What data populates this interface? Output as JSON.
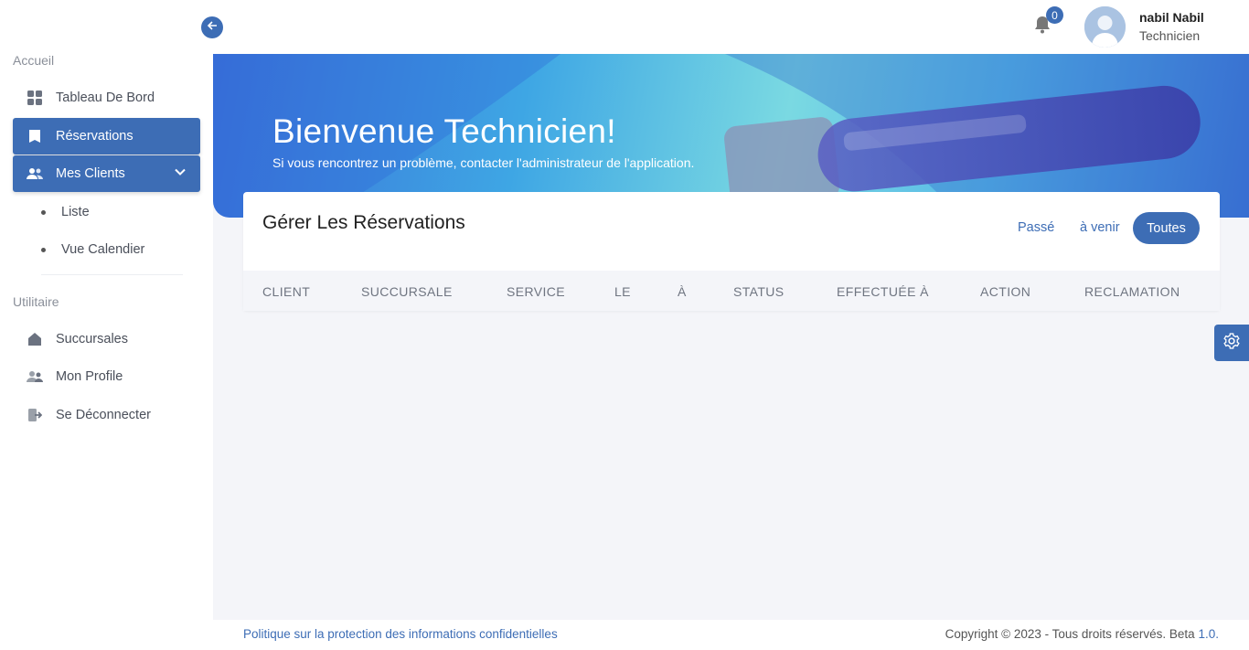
{
  "sidebar": {
    "section_home": "Accueil",
    "section_utility": "Utilitaire",
    "items": {
      "dashboard": "Tableau De Bord",
      "reservations": "Réservations",
      "clients": "Mes Clients",
      "list": "Liste",
      "calendar": "Vue Calendier",
      "branches": "Succursales",
      "profile": "Mon Profile",
      "logout": "Se Déconnecter"
    }
  },
  "header": {
    "notification_count": "0",
    "user_name": "nabil Nabil",
    "user_role": "Technicien"
  },
  "banner": {
    "title": "Bienvenue Technicien!",
    "subtitle": "Si vous rencontrez un problème, contacter l'administrateur de l'application."
  },
  "card": {
    "title": "Gérer Les Réservations",
    "filters": {
      "past": "Passé",
      "upcoming": "à venir",
      "all": "Toutes"
    },
    "columns": [
      "CLIENT",
      "SUCCURSALE",
      "SERVICE",
      "LE",
      "À",
      "STATUS",
      "EFFECTUÉE À",
      "ACTION",
      "RECLAMATION"
    ]
  },
  "footer": {
    "privacy": "Politique sur la protection des informations confidentielles",
    "copyright": "Copyright © 2023 - Tous droits réservés. Beta",
    "version": "1.0."
  },
  "colors": {
    "accent": "#3d6db5",
    "background": "#f4f5f9"
  }
}
